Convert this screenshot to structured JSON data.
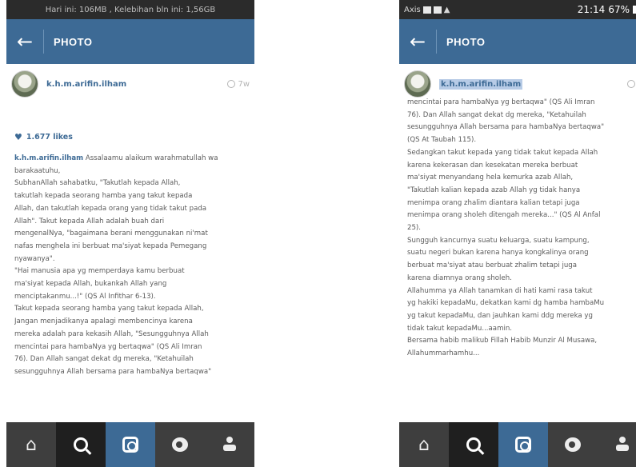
{
  "screens": [
    {
      "statusbar": {
        "text": "Hari ini: 106MB , Kelebihan bln ini: 1,56GB"
      },
      "appbar": {
        "title": "PHOTO"
      },
      "post": {
        "username": "k.h.m.arifin.ilham",
        "time": "7w",
        "likes": "1.677 likes",
        "caption_lines": [
          "Assalaamu alaikum warahmatullah wa",
          "barakaatuhu,",
          "SubhanAllah sahabatku, \"Takutlah kepada Allah,",
          "takutlah kepada seorang hamba yang takut kepada",
          "Allah, dan takutlah kepada orang yang tidak takut pada",
          "Allah\". Takut kepada Allah adalah buah dari",
          "mengenalNya, \"bagaimana berani menggunakan ni'mat",
          "nafas menghela ini berbuat ma'siyat kepada Pemegang",
          "nyawanya\".",
          "\"Hai manusia apa yg memperdaya kamu berbuat",
          "ma'siyat kepada Allah, bukankah Allah yang",
          "menciptakanmu...!\" (QS Al Infithar 6-13).",
          "Takut kepada seorang hamba yang takut kepada Allah,",
          "Jangan menjadikanya apalagi membencinya karena",
          "mereka adalah para kekasih Allah, \"Sesungguhnya Allah",
          "mencintai para hambaNya yg bertaqwa\" (QS Ali Imran",
          "76). Dan Allah sangat dekat dg mereka, \"Ketahuilah",
          "sesungguhnya Allah bersama para hambaNya bertaqwa\""
        ]
      },
      "nav": [
        "home-icon",
        "search-icon",
        "camera-icon",
        "activity-icon",
        "profile-icon"
      ]
    },
    {
      "statusbar": {
        "left_text": "Axis",
        "time": "21:14",
        "battery": "67%"
      },
      "appbar": {
        "title": "PHOTO"
      },
      "post": {
        "username": "k.h.m.arifin.ilham",
        "time": "7",
        "caption_lines": [
          "mencintai para hambaNya yg bertaqwa\" (QS Ali Imran",
          "76). Dan Allah sangat dekat dg mereka, \"Ketahuilah",
          "sesungguhnya Allah bersama para hambaNya bertaqwa\"",
          "(QS At Taubah 115).",
          "Sedangkan takut kepada yang tidak takut kepada Allah",
          "karena kekerasan dan kesekatan mereka berbuat",
          "ma'siyat menyandang hela kemurka azab Allah,",
          "\"Takutlah kalian kepada azab Allah yg tidak hanya",
          "menimpa orang zhalim diantara kalian tetapi juga",
          "menimpa orang sholeh ditengah mereka...\" (QS Al Anfal",
          "25).",
          "Sungguh kancurnya suatu keluarga, suatu kampung,",
          "suatu negeri bukan karena hanya kongkalinya orang",
          "berbuat ma'siyat atau berbuat zhalim tetapi juga",
          "karena diamnya orang sholeh.",
          "Allahumma ya Allah tanamkan di hati kami rasa takut",
          "yg hakiki kepadaMu, dekatkan kami dg hamba hambaMu",
          "yg takut kepadaMu, dan jauhkan kami ddg mereka yg",
          "tidak takut kepadaMu...aamin.",
          "Bersama habib malikub Fillah Habib Munzir Al Musawa,",
          "Allahummarhamhu..."
        ]
      },
      "nav": [
        "home-icon",
        "search-icon",
        "camera-icon",
        "activity-icon",
        "profile-icon"
      ]
    }
  ]
}
